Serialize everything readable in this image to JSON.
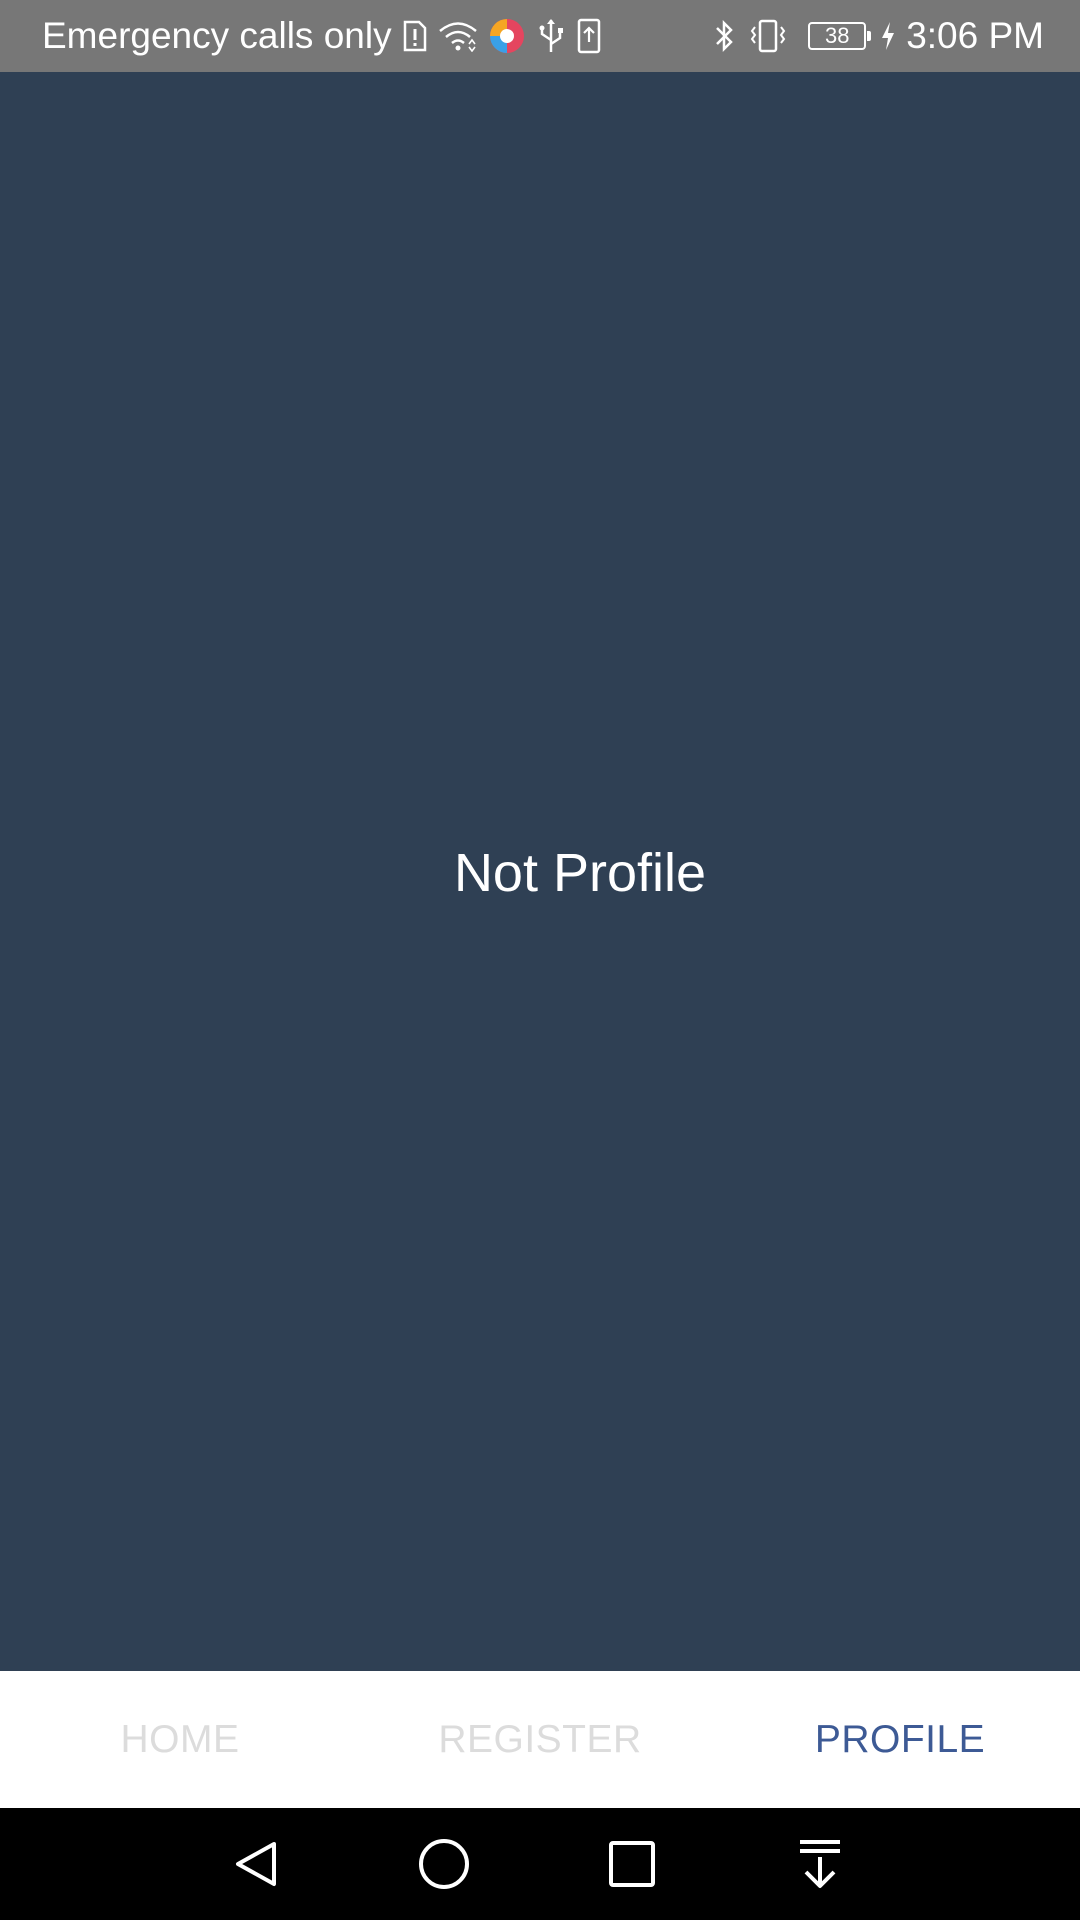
{
  "status_bar": {
    "carrier": "Emergency calls only",
    "battery_level": "38",
    "time": "3:06 PM",
    "icons": [
      "sim-alert-icon",
      "wifi-icon",
      "app-notification-icon",
      "usb-icon",
      "screenshot-icon",
      "bluetooth-icon",
      "vibrate-icon",
      "battery-icon",
      "charging-icon"
    ]
  },
  "content": {
    "message": "Not Profile"
  },
  "tabs": [
    {
      "label": "HOME",
      "active": false
    },
    {
      "label": "REGISTER",
      "active": false
    },
    {
      "label": "PROFILE",
      "active": true
    }
  ],
  "nav_bar": {
    "icons": [
      "back-icon",
      "home-icon",
      "recents-icon",
      "notification-pull-icon"
    ]
  },
  "colors": {
    "status_bar_bg": "#777777",
    "content_bg": "#2f4054",
    "tab_active": "#3d5a95",
    "tab_inactive": "#dcdcdc",
    "nav_bar_bg": "#000000"
  }
}
